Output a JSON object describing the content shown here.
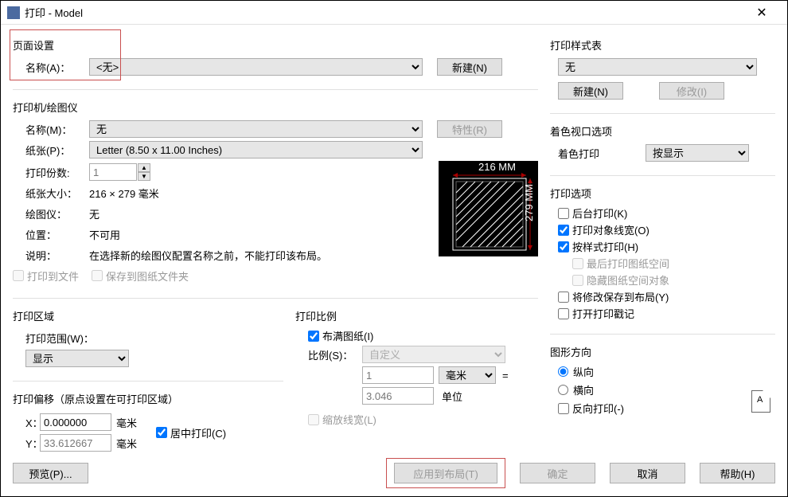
{
  "window": {
    "title": "打印 - Model"
  },
  "pageSetup": {
    "group": "页面设置",
    "nameLabel": "名称(A)：",
    "nameValue": "<无>",
    "newBtn": "新建(N)"
  },
  "printer": {
    "group": "打印机/绘图仪",
    "nameLabel": "名称(M)：",
    "nameValue": "无",
    "propsBtn": "特性(R)",
    "paperLabel": "纸张(P)：",
    "paperValue": "Letter (8.50 x 11.00 Inches)",
    "copiesLabel": "打印份数:",
    "copiesValue": "1",
    "paperSizeLabel": "纸张大小：",
    "paperSizeValue": "216 × 279  毫米",
    "plotterLabel": "绘图仪：",
    "plotterValue": "无",
    "locationLabel": "位置：",
    "locationValue": "不可用",
    "noteLabel": "说明：",
    "noteValue": "在选择新的绘图仪配置名称之前，不能打印该布局。",
    "printToFile": "打印到文件",
    "saveToFolder": "保存到图纸文件夹",
    "preview": {
      "width": "216 MM",
      "height": "279 MM"
    }
  },
  "printArea": {
    "group": "打印区域",
    "rangeLabel": "打印范围(W)：",
    "rangeValue": "显示"
  },
  "offset": {
    "group": "打印偏移（原点设置在可打印区域）",
    "xLabel": "X：",
    "xValue": "0.000000",
    "yLabel": "Y：",
    "yValue": "33.612667",
    "unit": "毫米",
    "center": "居中打印(C)"
  },
  "scale": {
    "group": "打印比例",
    "fit": "布满图纸(I)",
    "scaleLabel": "比例(S)：",
    "scaleValue": "自定义",
    "num": "1",
    "numUnit": "毫米",
    "eq": "=",
    "denom": "3.046",
    "denomUnit": "单位",
    "scaleLW": "缩放线宽(L)"
  },
  "styleTable": {
    "group": "打印样式表",
    "value": "无",
    "newBtn": "新建(N)",
    "editBtn": "修改(I)"
  },
  "shaded": {
    "group": "着色视口选项",
    "label": "着色打印",
    "value": "按显示"
  },
  "options": {
    "group": "打印选项",
    "bg": "后台打印(K)",
    "lw": "打印对象线宽(O)",
    "byStyle": "按样式打印(H)",
    "last": "最后打印图纸空间",
    "hide": "隐藏图纸空间对象",
    "save": "将修改保存到布局(Y)",
    "stamp": "打开打印戳记"
  },
  "orient": {
    "group": "图形方向",
    "portrait": "纵向",
    "landscape": "横向",
    "reverse": "反向打印(-)"
  },
  "footer": {
    "preview": "预览(P)...",
    "apply": "应用到布局(T)",
    "ok": "确定",
    "cancel": "取消",
    "help": "帮助(H)"
  }
}
